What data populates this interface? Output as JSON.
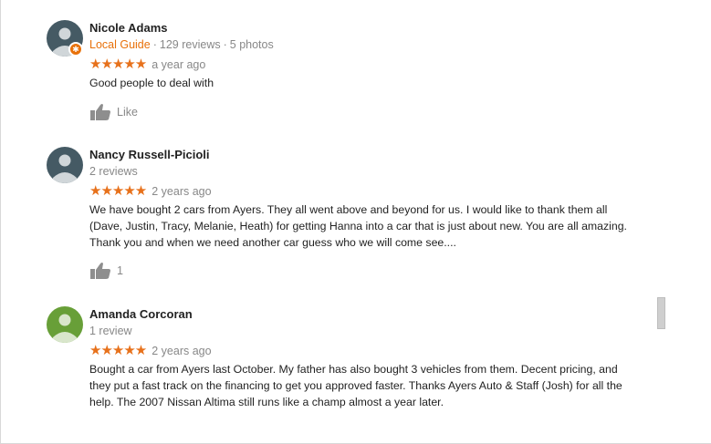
{
  "reviews": [
    {
      "name": "Nicole Adams",
      "local_guide": "Local Guide",
      "reviews_count": "129 reviews",
      "photos_count": "5 photos",
      "stars": "★★★★★",
      "time": "a year ago",
      "text": "Good people to deal with",
      "like_label": "Like",
      "avatar_color": "#455a64"
    },
    {
      "name": "Nancy Russell-Picioli",
      "reviews_count": "2 reviews",
      "stars": "★★★★★",
      "time": "2 years ago",
      "text": "We have bought 2 cars from Ayers.  They all went above and beyond for us.  I would like to thank them all (Dave, Justin, Tracy, Melanie, Heath) for getting Hanna into a car that is just about new.  You are all amazing.  Thank you and when we need another car guess who we will come see....",
      "like_count": "1",
      "avatar_color": "#455a64"
    },
    {
      "name": "Amanda Corcoran",
      "reviews_count": "1 review",
      "stars": "★★★★★",
      "time": "2 years ago",
      "text": "Bought a car from Ayers last October. My father has also bought 3 vehicles from them. Decent pricing, and they put a fast track on the financing to get you approved faster. Thanks Ayers Auto & Staff (Josh) for all the help. The 2007 Nissan Altima  still runs like a champ almost a year later.",
      "avatar_color": "#689f38"
    }
  ],
  "colors": {
    "accent_orange": "#e8710a",
    "star": "#e7711b",
    "meta_gray": "#888888"
  }
}
